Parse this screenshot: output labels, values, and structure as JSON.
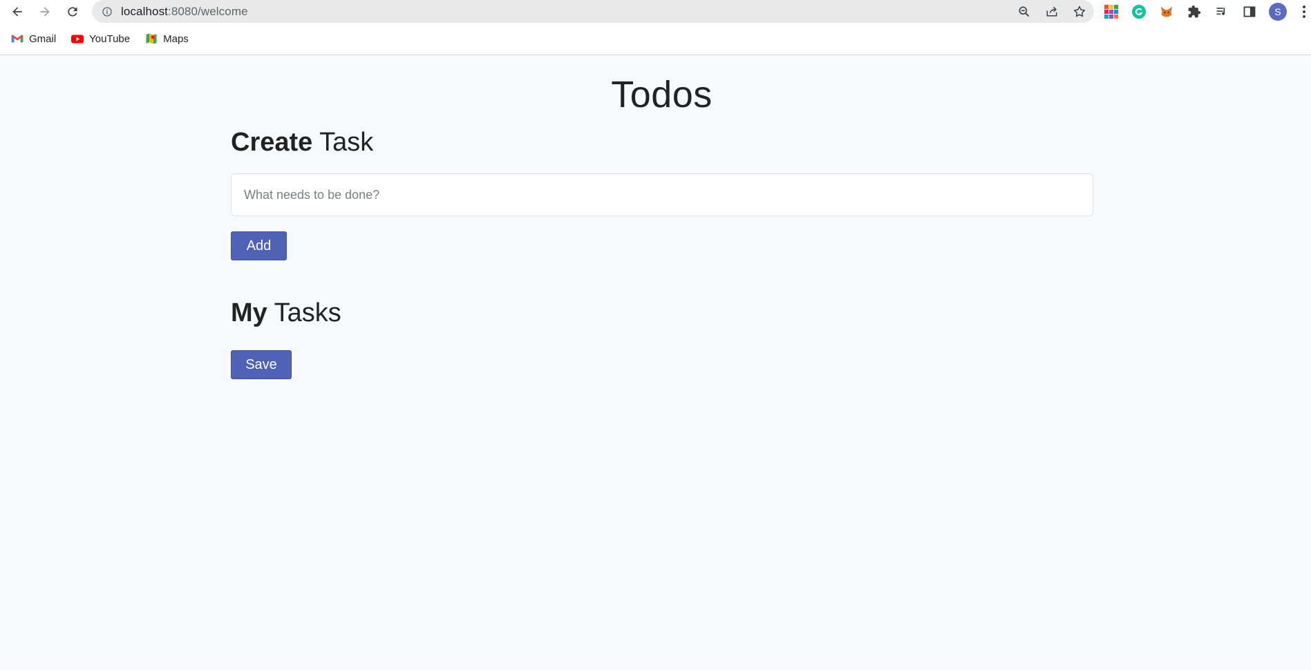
{
  "browser": {
    "url_host": "localhost",
    "url_path": ":8080/welcome",
    "avatar_letter": "S",
    "bookmarks": [
      {
        "label": "Gmail",
        "icon": "gmail-icon"
      },
      {
        "label": "YouTube",
        "icon": "youtube-icon"
      },
      {
        "label": "Maps",
        "icon": "maps-icon"
      }
    ]
  },
  "page": {
    "title": "Todos",
    "create_section": {
      "bold": "Create",
      "rest": " Task"
    },
    "task_input": {
      "placeholder": "What needs to be done?",
      "value": ""
    },
    "add_label": "Add",
    "my_section": {
      "bold": "My",
      "rest": " Tasks"
    },
    "save_label": "Save"
  },
  "colors": {
    "accent": "#4f62b5",
    "page_background": "#f8f9fd"
  }
}
